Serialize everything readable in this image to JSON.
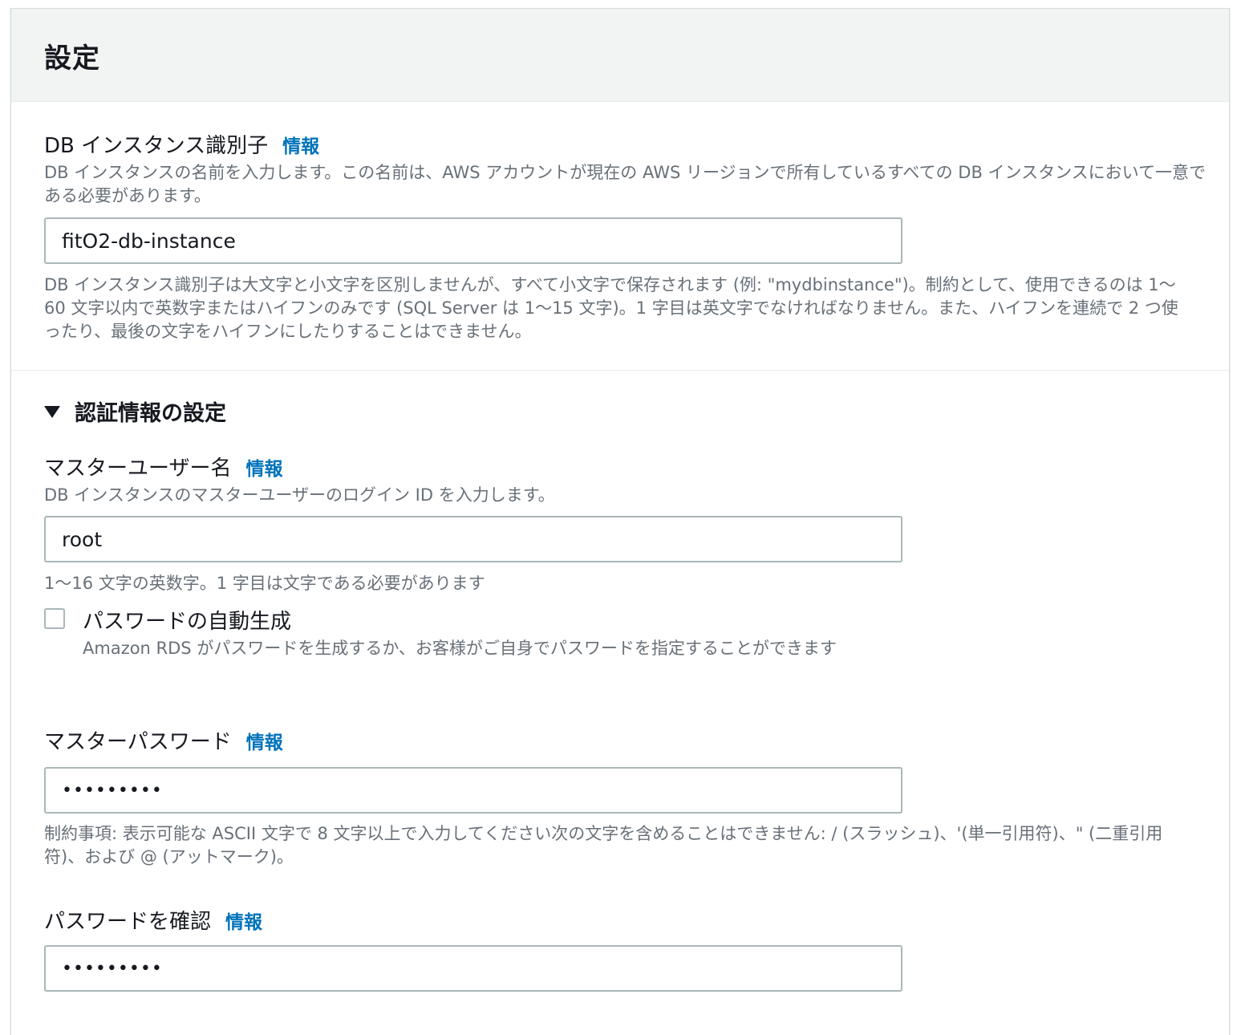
{
  "settings": {
    "title": "設定"
  },
  "db_identifier": {
    "label": "DB インスタンス識別子",
    "info": "情報",
    "description": "DB インスタンスの名前を入力します。この名前は、AWS アカウントが現在の AWS リージョンで所有しているすべての DB インスタンスにおいて一意である必要があります。",
    "value": "fitO2-db-instance",
    "constraint": "DB インスタンス識別子は大文字と小文字を区別しませんが、すべて小文字で保存されます (例: \"mydbinstance\")。制約として、使用できるのは 1〜60 文字以内で英数字またはハイフンのみです (SQL Server は 1〜15 文字)。1 字目は英文字でなければなりません。また、ハイフンを連続で 2 つ使ったり、最後の文字をハイフンにしたりすることはできません。"
  },
  "credentials": {
    "section_title": "認証情報の設定",
    "master_username": {
      "label": "マスターユーザー名",
      "info": "情報",
      "description": "DB インスタンスのマスターユーザーのログイン ID を入力します。",
      "value": "root",
      "constraint": "1〜16 文字の英数字。1 字目は文字である必要があります"
    },
    "auto_generate": {
      "label": "パスワードの自動生成",
      "checked": false,
      "description": "Amazon RDS がパスワードを生成するか、お客様がご自身でパスワードを指定することができます"
    },
    "master_password": {
      "label": "マスターパスワード",
      "info": "情報",
      "value": "•••••••••",
      "constraint": "制約事項: 表示可能な ASCII 文字で 8 文字以上で入力してください次の文字を含めることはできません: / (スラッシュ)、'(単一引用符)、\" (二重引用符)、および @ (アットマーク)。"
    },
    "confirm_password": {
      "label": "パスワードを確認",
      "info": "情報",
      "value": "•••••••••"
    }
  }
}
